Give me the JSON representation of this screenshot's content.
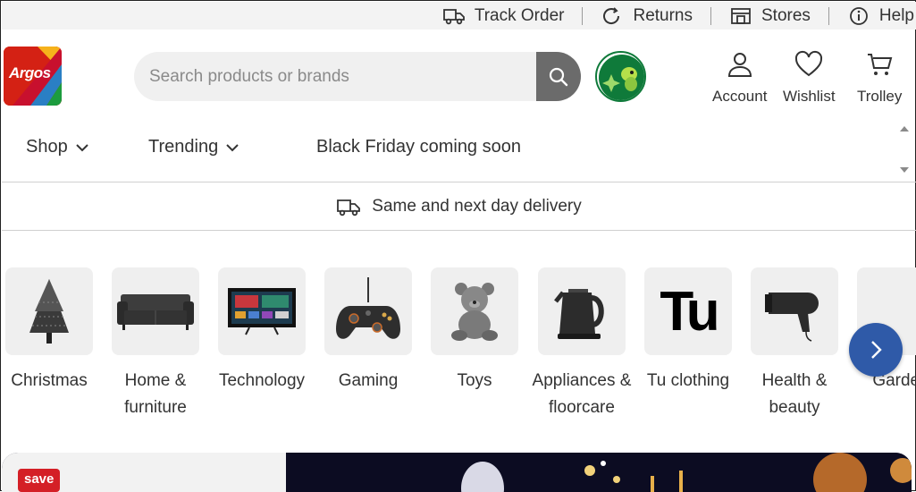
{
  "utility": {
    "track_order": "Track Order",
    "returns": "Returns",
    "stores": "Stores",
    "help": "Help"
  },
  "logo": {
    "text": "Argos"
  },
  "search": {
    "placeholder": "Search products or brands"
  },
  "header": {
    "account": "Account",
    "wishlist": "Wishlist",
    "trolley": "Trolley"
  },
  "nav": {
    "shop": "Shop",
    "trending": "Trending",
    "promo": "Black Friday coming soon"
  },
  "delivery": {
    "text": "Same and next day delivery"
  },
  "categories": [
    {
      "line1": "Christmas",
      "line2": ""
    },
    {
      "line1": "Home &",
      "line2": "furniture"
    },
    {
      "line1": "Technology",
      "line2": ""
    },
    {
      "line1": "Gaming",
      "line2": ""
    },
    {
      "line1": "Toys",
      "line2": ""
    },
    {
      "line1": "Appliances &",
      "line2": "floorcare"
    },
    {
      "line1": "Tu clothing",
      "line2": ""
    },
    {
      "line1": "Health &",
      "line2": "beauty"
    },
    {
      "line1": "Garden",
      "line2": ""
    }
  ],
  "tu_logo": "Tu",
  "banner": {
    "badge": "save"
  },
  "colors": {
    "accent_blue": "#2f5aa8",
    "brand_red": "#d42114",
    "save_red": "#d41f26",
    "nectar_green": "#0f7a3a"
  }
}
